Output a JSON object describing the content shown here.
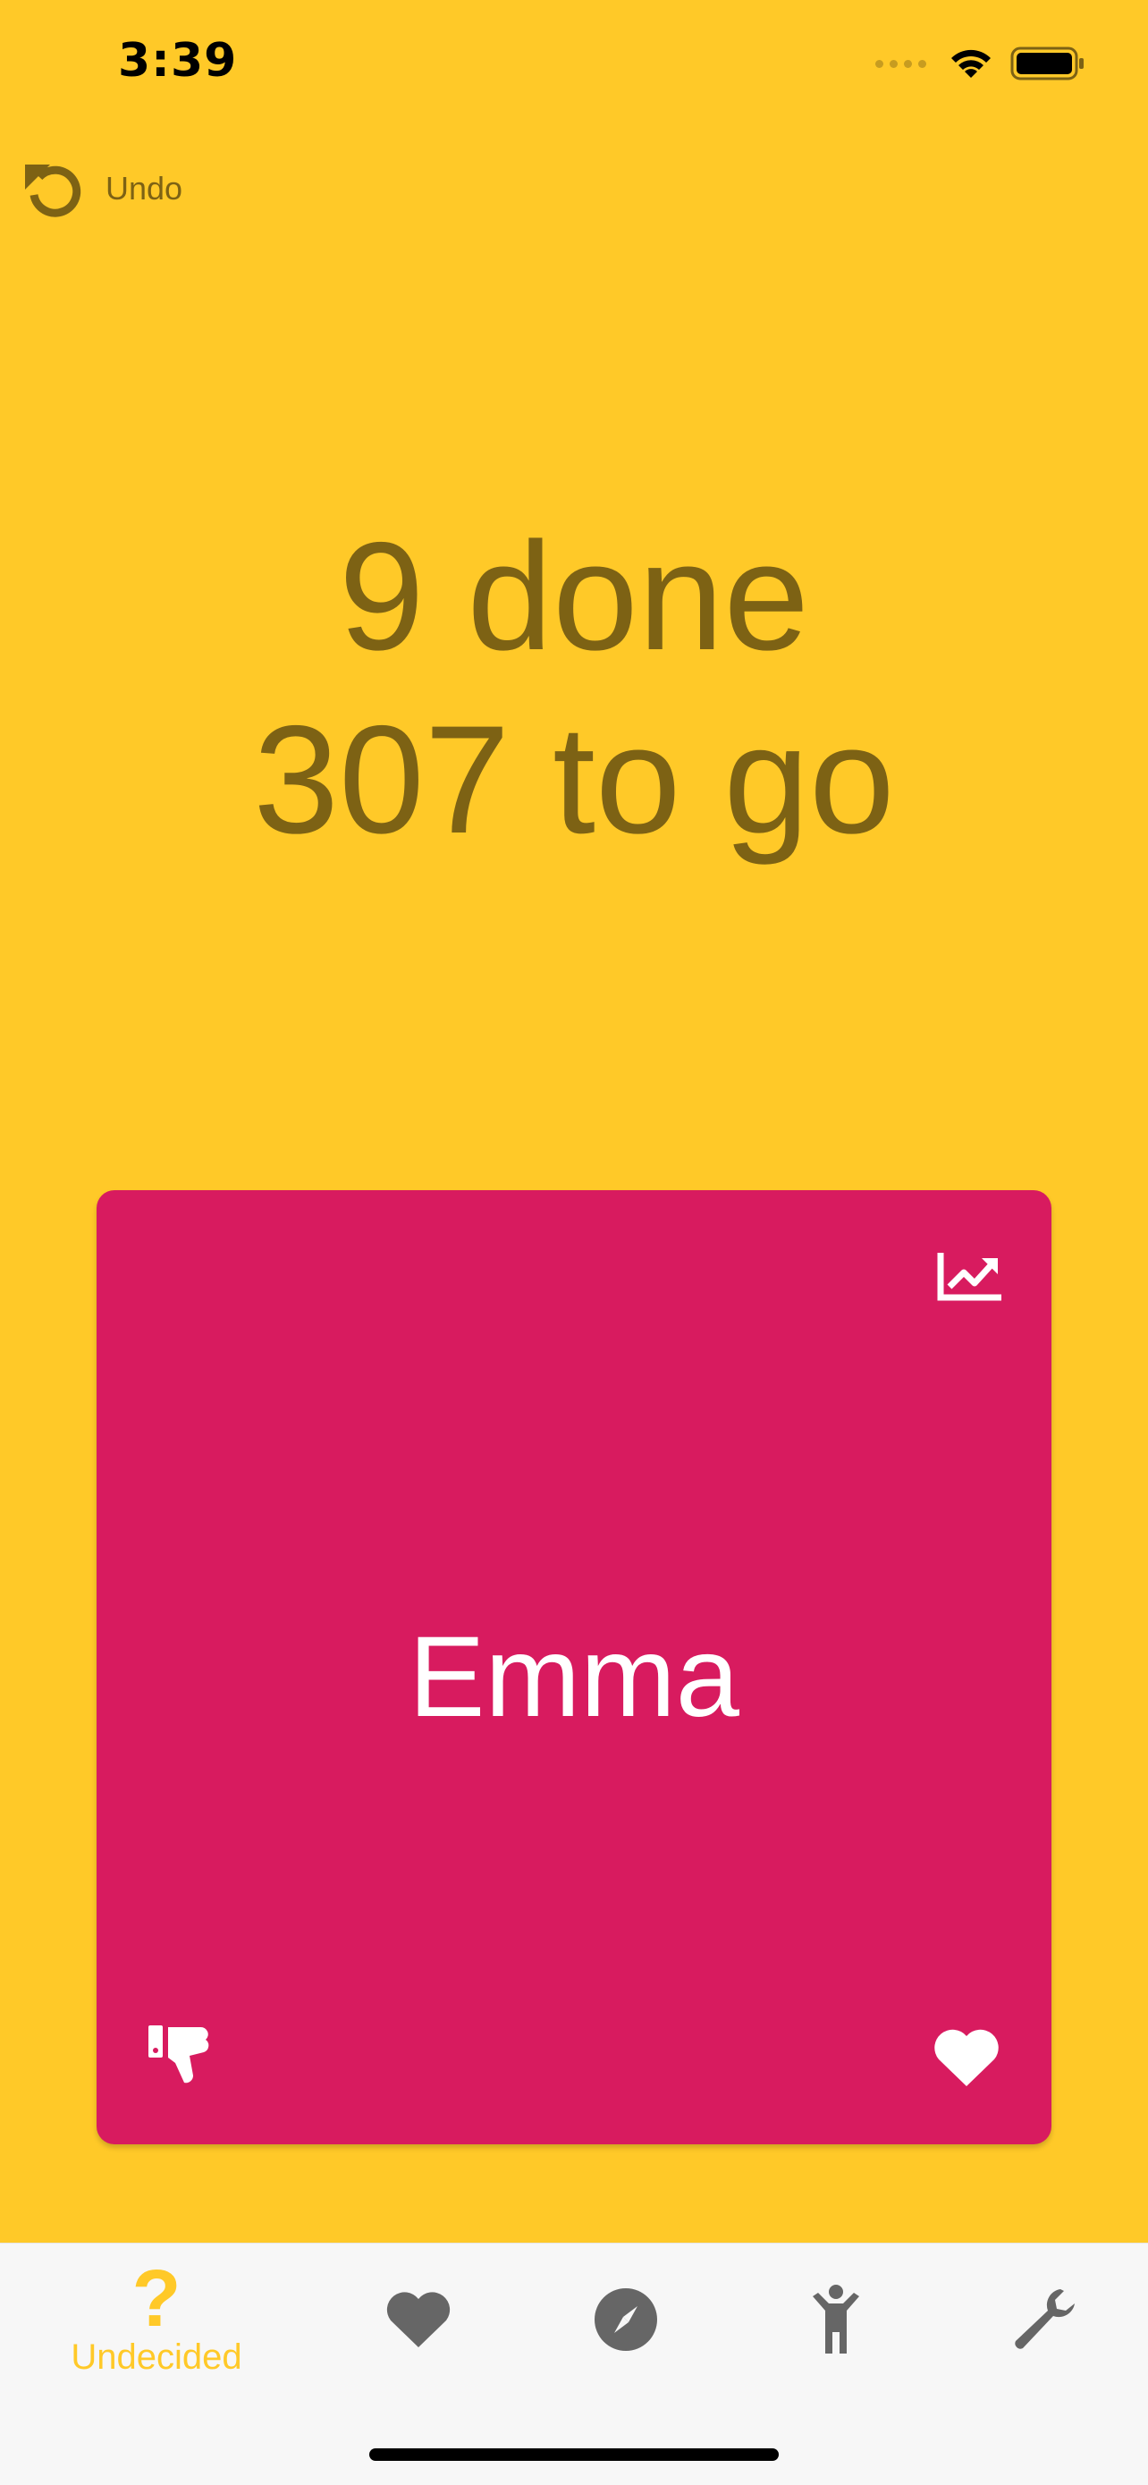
{
  "status_bar": {
    "time": "3:39"
  },
  "toolbar": {
    "undo_label": "Undo"
  },
  "progress": {
    "done_text": "9 done",
    "remaining_text": "307 to go"
  },
  "card": {
    "name": "Emma",
    "color": "#D81B5F"
  },
  "tabs": [
    {
      "label": "Undecided",
      "icon": "question-icon",
      "active": true
    },
    {
      "label": "",
      "icon": "heart-icon",
      "active": false
    },
    {
      "label": "",
      "icon": "compass-icon",
      "active": false
    },
    {
      "label": "",
      "icon": "child-icon",
      "active": false
    },
    {
      "label": "",
      "icon": "wrench-icon",
      "active": false
    }
  ],
  "colors": {
    "background": "#FFC928",
    "text_muted": "#7D6214",
    "tab_inactive": "#666666",
    "tab_active": "#FFC928"
  }
}
